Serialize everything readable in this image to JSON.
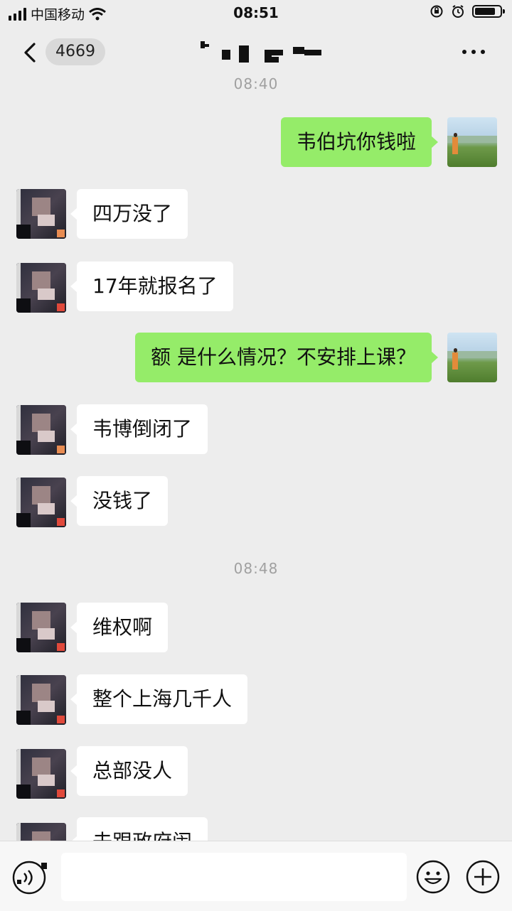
{
  "status_bar": {
    "carrier": "中国移动",
    "time": "08:51",
    "icons": [
      "signal-icon",
      "wifi-icon",
      "orientation-lock-icon",
      "alarm-icon",
      "battery-icon"
    ]
  },
  "nav": {
    "back_count": "4669",
    "title": "",
    "icons": [
      "back-chevron-icon",
      "more-icon"
    ]
  },
  "timestamps": [
    "08:40",
    "08:48"
  ],
  "messages": [
    {
      "from": "me",
      "text": "韦伯坑你钱啦"
    },
    {
      "from": "other",
      "text": "四万没了"
    },
    {
      "from": "other",
      "text": "17年就报名了"
    },
    {
      "from": "me",
      "text": "额 是什么情况？不安排上课？"
    },
    {
      "from": "other",
      "text": "韦博倒闭了"
    },
    {
      "from": "other",
      "text": "没钱了"
    },
    {
      "from": "other",
      "text": "维权啊"
    },
    {
      "from": "other",
      "text": "整个上海几千人"
    },
    {
      "from": "other",
      "text": "总部没人"
    },
    {
      "from": "other",
      "text": "去跟政府闹"
    }
  ],
  "input_bar": {
    "placeholder": "",
    "icons": [
      "voice-icon",
      "emoji-icon",
      "plus-icon"
    ]
  }
}
